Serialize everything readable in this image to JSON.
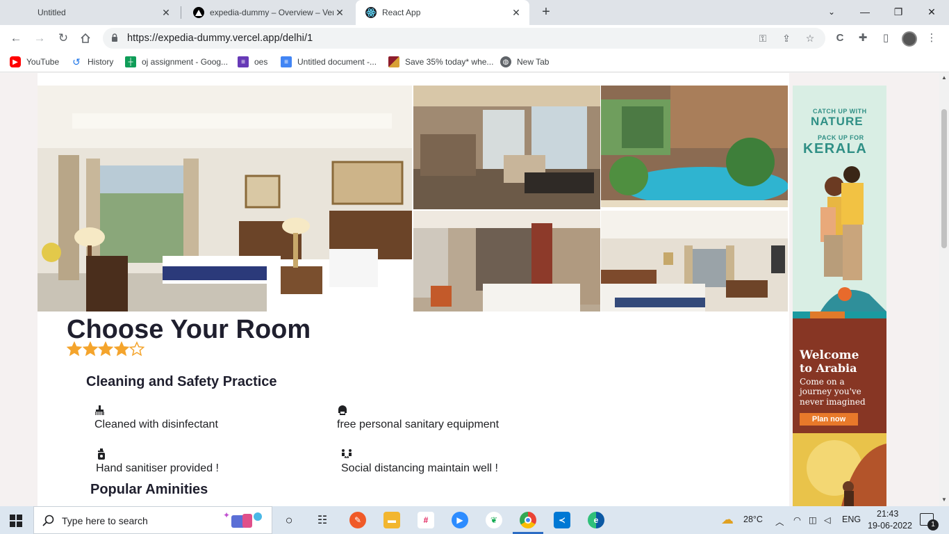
{
  "browser": {
    "tabs": [
      {
        "title": "Untitled",
        "active": false
      },
      {
        "title": "expedia-dummy – Overview – Vercel",
        "active": false
      },
      {
        "title": "React App",
        "active": true
      }
    ],
    "url": "https://expedia-dummy.vercel.app/delhi/1",
    "bookmarks": [
      {
        "label": "YouTube",
        "icon": "youtube-icon"
      },
      {
        "label": "History",
        "icon": "history-icon"
      },
      {
        "label": "oj assignment - Goog...",
        "icon": "sheets-icon"
      },
      {
        "label": "oes",
        "icon": "forms-icon"
      },
      {
        "label": "Untitled document -...",
        "icon": "docs-icon"
      },
      {
        "label": "Save 35% today* whe...",
        "icon": "promo-icon"
      },
      {
        "label": "New Tab",
        "icon": "globe-icon"
      }
    ]
  },
  "page": {
    "heading": "Choose Your Room",
    "rating": 4,
    "rating_max": 5,
    "cleaning": {
      "title": "Cleaning and Safety Practice",
      "items": [
        {
          "label": "Cleaned with disinfectant",
          "icon": "broom-icon"
        },
        {
          "label": "free personal sanitary equipment",
          "icon": "mask-icon"
        },
        {
          "label": "Hand sanitiser provided !",
          "icon": "sanitiser-icon"
        },
        {
          "label": "Social distancing maintain well !",
          "icon": "distancing-icon"
        }
      ]
    },
    "amenities_title": "Popular Aminities",
    "gallery": [
      "hotel-room-photo",
      "lounge-photo",
      "pool-photo",
      "suite-photo",
      "twin-room-photo"
    ]
  },
  "ads": {
    "kerala": {
      "line1": "CATCH UP WITH",
      "line2": "NATURE",
      "line3": "PACK UP FOR",
      "line4": "KERALA"
    },
    "arabia": {
      "title1": "Welcome",
      "title2": "to Arabia",
      "sub1": "Come on a",
      "sub2": "journey you've",
      "sub3": "never imagined",
      "cta": "Plan now"
    }
  },
  "taskbar": {
    "search_placeholder": "Type here to search",
    "weather": "28°C",
    "language": "ENG",
    "time": "21:43",
    "date": "19-06-2022",
    "notifications": "1"
  },
  "colors": {
    "star": "#f4a42c",
    "heading": "#1f1f2e",
    "arabia_cta": "#e8792a",
    "kerala_text": "#2f8f85"
  }
}
